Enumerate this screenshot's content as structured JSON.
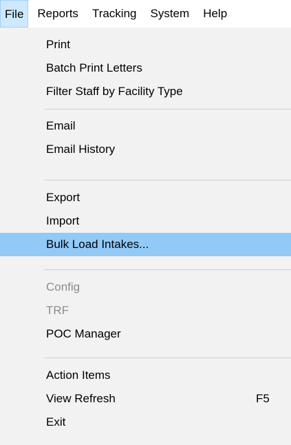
{
  "menubar": {
    "items": [
      {
        "label": "File"
      },
      {
        "label": "Reports"
      },
      {
        "label": "Tracking"
      },
      {
        "label": "System"
      },
      {
        "label": "Help"
      }
    ],
    "active": "File"
  },
  "file_menu": {
    "items": [
      {
        "label": "Print",
        "enabled": true
      },
      {
        "label": "Batch Print Letters",
        "enabled": true
      },
      {
        "label": "Filter Staff by Facility Type",
        "enabled": true
      },
      {
        "label": "Email",
        "enabled": true
      },
      {
        "label": "Email History",
        "enabled": true
      },
      {
        "label": "Export",
        "enabled": true
      },
      {
        "label": "Import",
        "enabled": true
      },
      {
        "label": "Bulk Load Intakes...",
        "enabled": true,
        "highlighted": true
      },
      {
        "label": "Config",
        "enabled": false
      },
      {
        "label": "TRF",
        "enabled": false
      },
      {
        "label": "POC Manager",
        "enabled": true
      },
      {
        "label": "Action Items",
        "enabled": true
      },
      {
        "label": "View Refresh",
        "enabled": true,
        "shortcut": "F5"
      },
      {
        "label": "Exit",
        "enabled": true
      }
    ]
  },
  "colors": {
    "menu_background": "#f2f2f2",
    "menubar_background": "#ffffff",
    "highlight": "#91c9f7",
    "active_menubar_item": "#cde8ff",
    "disabled_text": "#8d8d8d",
    "separator": "#cfcfcf"
  }
}
